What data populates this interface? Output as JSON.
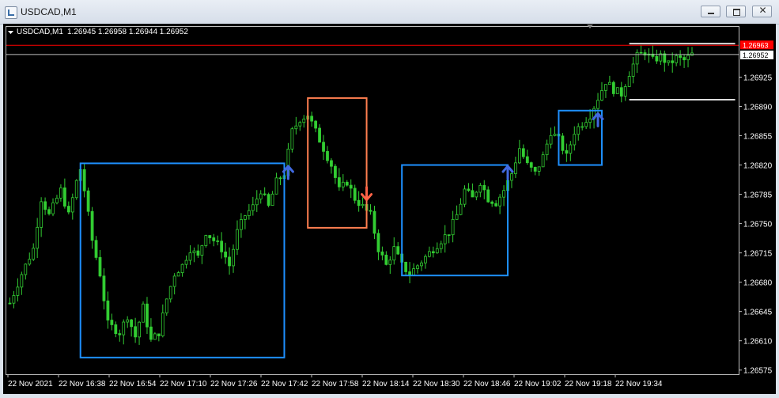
{
  "window": {
    "title": "USDCAD,M1",
    "controls": {
      "minimize": "minimize",
      "maximize": "maximize",
      "close": "✕"
    }
  },
  "chart_header": {
    "symbol": "USDCAD,M1",
    "ohlc": "1.26945 1.26958 1.26944 1.26952"
  },
  "colors": {
    "background": "#000000",
    "candle": "#32cd32",
    "frame": "#c0c0c0",
    "ask_line": "#ff0000",
    "bid_line": "#c0c0c0",
    "blue_box": "#1e90ff",
    "orange_box": "#ff7f50",
    "arrow_up": "#4169e1",
    "arrow_down": "#ff6347"
  },
  "chart_data": {
    "type": "candlestick",
    "symbol": "USDCAD",
    "timeframe": "M1",
    "ylim": [
      1.2657,
      1.26985
    ],
    "y_ticks": [
      "1.26925",
      "1.26890",
      "1.26855",
      "1.26820",
      "1.26785",
      "1.26750",
      "1.26715",
      "1.26680",
      "1.26645",
      "1.26610",
      "1.26575"
    ],
    "x_ticks": [
      "22 Nov 2021",
      "22 Nov 16:38",
      "22 Nov 16:54",
      "22 Nov 17:10",
      "22 Nov 17:26",
      "22 Nov 17:42",
      "22 Nov 17:58",
      "22 Nov 18:14",
      "22 Nov 18:30",
      "22 Nov 18:46",
      "22 Nov 19:02",
      "22 Nov 19:18",
      "22 Nov 19:34"
    ],
    "ask_label": "1.26963",
    "bid_label": "1.26952",
    "ask": 1.26963,
    "bid": 1.26952,
    "close_path": [
      [
        0,
        1.26655
      ],
      [
        3,
        1.2669
      ],
      [
        6,
        1.2672
      ],
      [
        8,
        1.2678
      ],
      [
        10,
        1.2676
      ],
      [
        13,
        1.2679
      ],
      [
        15,
        1.2676
      ],
      [
        17,
        1.268
      ],
      [
        18,
        1.26815
      ],
      [
        19,
        1.2679
      ],
      [
        21,
        1.2673
      ],
      [
        23,
        1.2669
      ],
      [
        25,
        1.2663
      ],
      [
        28,
        1.2662
      ],
      [
        30,
        1.2664
      ],
      [
        32,
        1.26615
      ],
      [
        34,
        1.2665
      ],
      [
        36,
        1.2661
      ],
      [
        38,
        1.2662
      ],
      [
        40,
        1.2666
      ],
      [
        42,
        1.2669
      ],
      [
        44,
        1.267
      ],
      [
        46,
        1.2672
      ],
      [
        48,
        1.2671
      ],
      [
        50,
        1.2674
      ],
      [
        52,
        1.2673
      ],
      [
        54,
        1.2672
      ],
      [
        56,
        1.267
      ],
      [
        58,
        1.2674
      ],
      [
        60,
        1.2676
      ],
      [
        62,
        1.2677
      ],
      [
        64,
        1.2679
      ],
      [
        66,
        1.2677
      ],
      [
        68,
        1.268
      ],
      [
        70,
        1.2681
      ],
      [
        72,
        1.2686
      ],
      [
        74,
        1.26875
      ],
      [
        76,
        1.2688
      ],
      [
        78,
        1.2686
      ],
      [
        80,
        1.2684
      ],
      [
        82,
        1.2682
      ],
      [
        84,
        1.2679
      ],
      [
        86,
        1.268
      ],
      [
        88,
        1.2678
      ],
      [
        90,
        1.2677
      ],
      [
        92,
        1.2676
      ],
      [
        94,
        1.2672
      ],
      [
        96,
        1.267
      ],
      [
        98,
        1.2672
      ],
      [
        100,
        1.267
      ],
      [
        102,
        1.2669
      ],
      [
        104,
        1.267
      ],
      [
        106,
        1.2671
      ],
      [
        108,
        1.2672
      ],
      [
        110,
        1.2673
      ],
      [
        112,
        1.2674
      ],
      [
        114,
        1.2676
      ],
      [
        116,
        1.2679
      ],
      [
        118,
        1.2678
      ],
      [
        120,
        1.268
      ],
      [
        122,
        1.2678
      ],
      [
        124,
        1.26775
      ],
      [
        126,
        1.2679
      ],
      [
        128,
        1.2681
      ],
      [
        130,
        1.2684
      ],
      [
        132,
        1.2682
      ],
      [
        134,
        1.2681
      ],
      [
        136,
        1.2683
      ],
      [
        138,
        1.2686
      ],
      [
        140,
        1.2685
      ],
      [
        142,
        1.2683
      ],
      [
        144,
        1.2686
      ],
      [
        146,
        1.2687
      ],
      [
        148,
        1.2688
      ],
      [
        150,
        1.269
      ],
      [
        152,
        1.2692
      ],
      [
        154,
        1.2691
      ],
      [
        156,
        1.26905
      ],
      [
        158,
        1.2693
      ],
      [
        160,
        1.2695
      ],
      [
        162,
        1.26955
      ],
      [
        164,
        1.26945
      ],
      [
        166,
        1.2695
      ],
      [
        168,
        1.2694
      ],
      [
        170,
        1.26948
      ],
      [
        172,
        1.26945
      ],
      [
        174,
        1.26952
      ]
    ],
    "boxes": [
      {
        "color": "blue",
        "start": 18,
        "end": 70,
        "high": 1.26822,
        "low": 1.2659
      },
      {
        "color": "orange",
        "start": 76,
        "end": 91,
        "high": 1.269,
        "low": 1.26745
      },
      {
        "color": "blue",
        "start": 100,
        "end": 127,
        "high": 1.2682,
        "low": 1.26688
      },
      {
        "color": "blue",
        "start": 140,
        "end": 151,
        "high": 1.26885,
        "low": 1.2682
      },
      {
        "color": "white",
        "start": 158,
        "end": 185,
        "high": 1.26965,
        "low": 1.26898
      }
    ],
    "arrows": [
      {
        "direction": "up",
        "bar": 71,
        "price": 1.26812
      },
      {
        "direction": "down",
        "bar": 91,
        "price": 1.26785
      },
      {
        "direction": "up",
        "bar": 127,
        "price": 1.26812
      },
      {
        "direction": "up",
        "bar": 150,
        "price": 1.26875
      }
    ]
  }
}
